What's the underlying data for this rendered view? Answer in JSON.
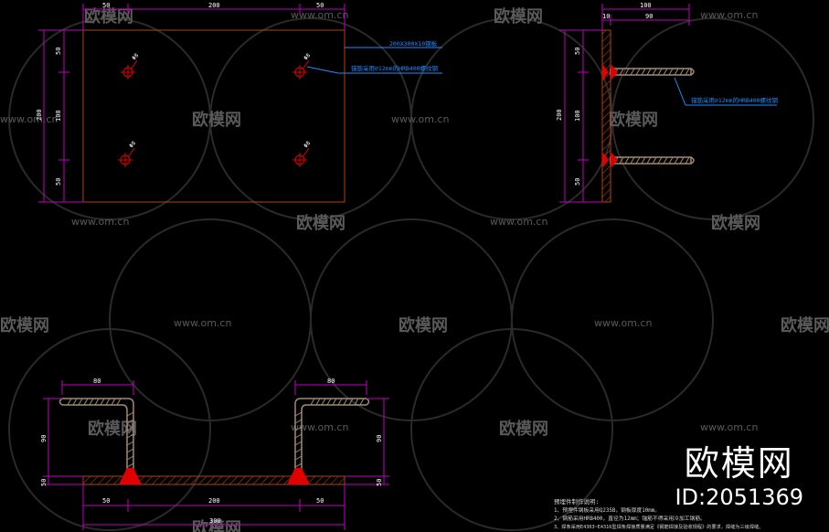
{
  "watermark": {
    "brand": "欧模网",
    "site": "www.om.cn"
  },
  "brand_block": {
    "name": "欧模网",
    "id": "ID:2051369"
  },
  "plan_view": {
    "dim_top_left": "50",
    "dim_top_mid": "200",
    "dim_top_right": "50",
    "dim_left_top": "50",
    "dim_left_mid": "100",
    "dim_left_bot": "50",
    "dim_left_total": "200",
    "hole_label": "Φ8",
    "callout_plate": "200X300X10钢板",
    "callout_bar": "锚筋采用⌀12mm的HRB400螺纹钢"
  },
  "side_view": {
    "dim_top_total": "100",
    "dim_top_a": "10",
    "dim_top_b": "90",
    "dim_left_top": "50",
    "dim_left_mid": "100",
    "dim_left_bot": "50",
    "dim_left_total": "200",
    "callout_bar": "锚筋采用⌀12mm的HRB400螺纹钢"
  },
  "section_view": {
    "dim_hook_left": "80",
    "dim_hook_right": "80",
    "dim_h_left_top": "90",
    "dim_h_left_bot": "50",
    "dim_h_right_top": "90",
    "dim_h_right_bot": "50",
    "dim_bottom_left": "50",
    "dim_bottom_mid": "200",
    "dim_bottom_right": "50",
    "dim_bottom_total": "300"
  },
  "notes": {
    "title": "预埋件制作说明:",
    "line1": "1、预埋件钢板采用Q235B，钢板厚度10mm。",
    "line2": "2、钢筋采用HRB400，直径为12mm；锚筋不得采用冷加工钢筋。",
    "line3": "3、焊条采用E4303~E4316型焊条焊接质量满足《钢筋焊接及验收规程》的要求，焊缝为三级焊缝。"
  },
  "colors": {
    "background": "#000000",
    "watermark": "#5a5a5a",
    "dimension": "#c000c0",
    "callout": "#1c8cff",
    "plate": "#b04010",
    "weld": "#e00000",
    "rebar": "#a08a70"
  }
}
